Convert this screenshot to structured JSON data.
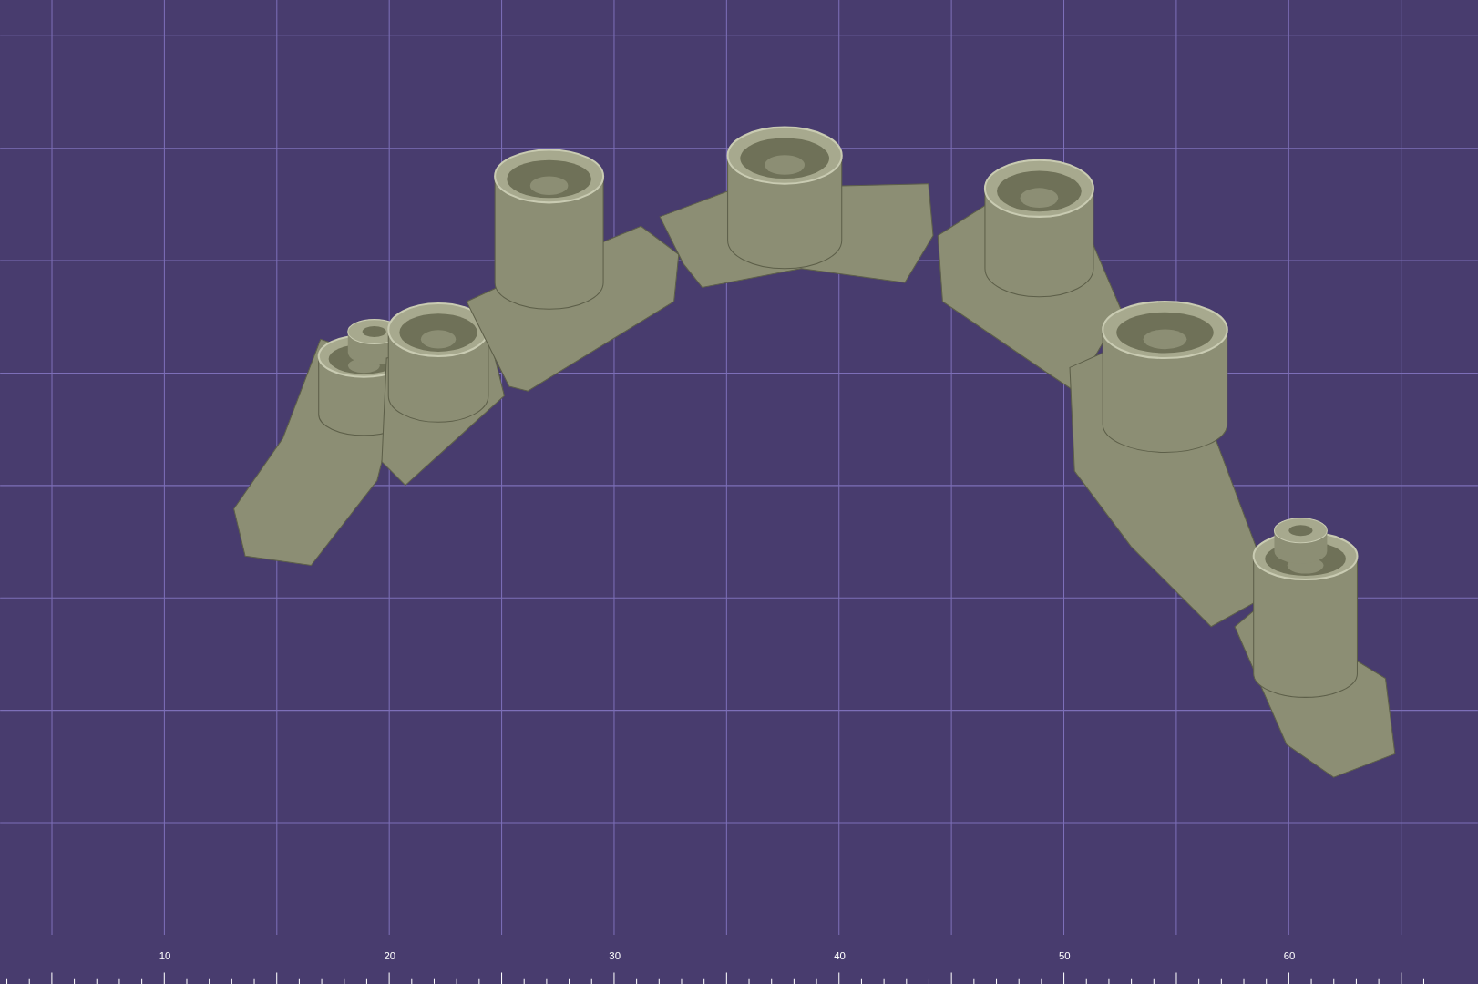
{
  "viewport": {
    "ruler": {
      "labels": [
        "10",
        "20",
        "30",
        "40",
        "50",
        "60"
      ]
    }
  }
}
